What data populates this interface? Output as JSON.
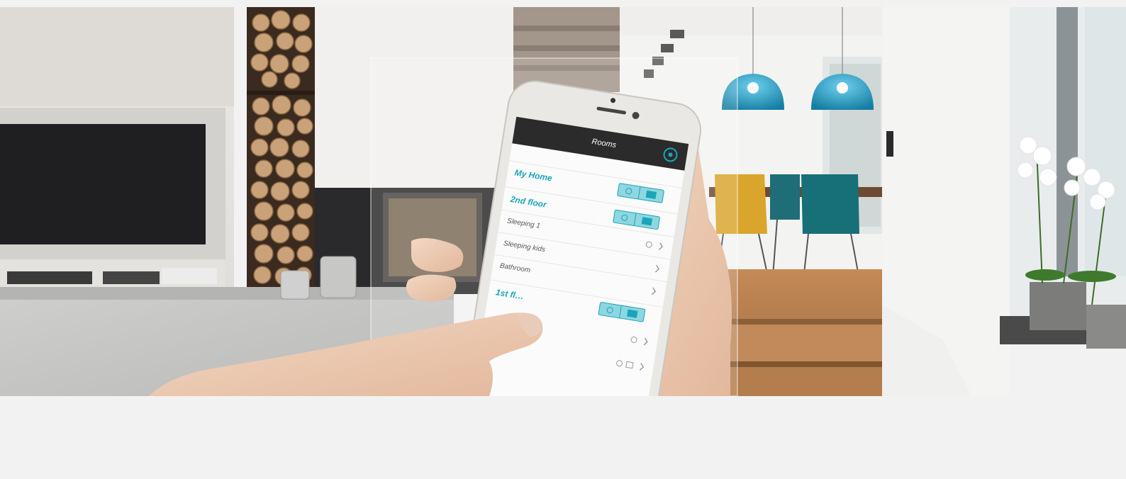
{
  "app": {
    "header_title": "Rooms"
  },
  "rooms": {
    "my_home": "My Home",
    "floor_2": "2nd floor",
    "items_2": [
      "Sleeping 1",
      "Sleeping kids",
      "Bathroom"
    ],
    "floor_1": "1st fl…"
  },
  "colors": {
    "accent": "#1aa5b8",
    "app_header": "#2b2b2b",
    "lamp": "#1b8db0",
    "chair_yellow": "#d9a52c",
    "chair_teal": "#176f78",
    "floor_wood": "#b57b4c"
  },
  "icons": [
    "bulb-icon",
    "shutter-icon",
    "chevron-right-icon",
    "settings-icon"
  ]
}
